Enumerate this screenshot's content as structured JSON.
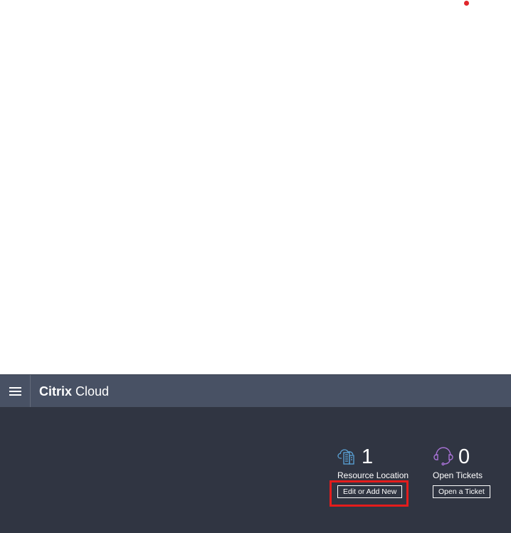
{
  "header": {
    "brand_bold": "Citrix",
    "brand_light": "Cloud"
  },
  "widgets": {
    "resource": {
      "icon": "cloud-building-icon",
      "count": "1",
      "label": "Resource Location",
      "button_label": "Edit or Add New",
      "icon_color": "#5aa3d8"
    },
    "tickets": {
      "icon": "headset-icon",
      "count": "0",
      "label": "Open Tickets",
      "button_label": "Open a Ticket",
      "icon_color": "#a872d6"
    }
  },
  "colors": {
    "header_bg": "#485164",
    "dashboard_bg": "#303542",
    "highlight": "#e41c1c"
  }
}
